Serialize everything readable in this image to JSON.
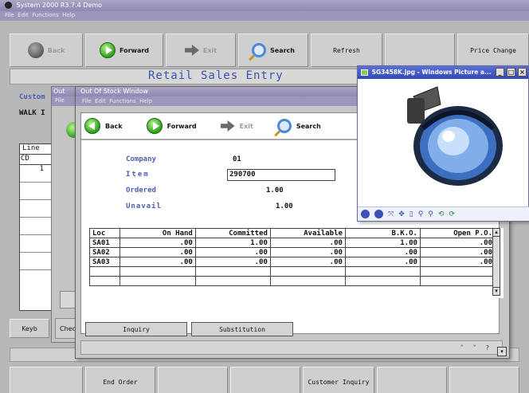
{
  "main_window": {
    "title": "System 2000 R3.7.4 Demo",
    "menu": [
      "File",
      "Edit",
      "Functions",
      "Help"
    ],
    "toolbar": {
      "back": "Back",
      "forward": "Forward",
      "exit": "Exit",
      "search": "Search",
      "refresh": "Refresh",
      "price_change": "Price Change"
    },
    "heading": "Retail Sales Entry",
    "customer_label": "Custom",
    "customer_value": "WALK I",
    "grid_headers": [
      "Line",
      "CD"
    ],
    "grid_first_row": "1",
    "keyb_label": "Keyb",
    "bottom_buttons": [
      "End Order",
      "Customer Inquiry"
    ]
  },
  "mid_window": {
    "title": "Out",
    "menu": [
      "File"
    ],
    "check_label": "Chec"
  },
  "oos_window": {
    "title": "Out Of Stock Window",
    "menu": [
      "File",
      "Edit",
      "Functions",
      "Help"
    ],
    "toolbar": {
      "back": "Back",
      "forward": "Forward",
      "exit": "Exit",
      "search": "Search"
    },
    "fields": {
      "company_label": "Company",
      "company_value": "01",
      "item_label": "Item",
      "item_value": "290700",
      "ordered_label": "Ordered",
      "ordered_value": "1.00",
      "unavail_label": "Unavail",
      "unavail_value": "1.00"
    },
    "table": {
      "headers": [
        "Loc",
        "On Hand",
        "Committed",
        "Available",
        "B.K.O.",
        "Open P.O."
      ],
      "rows": [
        [
          "SA01",
          ".00",
          "1.00",
          ".00",
          "1.00",
          ".00"
        ],
        [
          "SA02",
          ".00",
          ".00",
          ".00",
          ".00",
          ".00"
        ],
        [
          "SA03",
          ".00",
          ".00",
          ".00",
          ".00",
          ".00"
        ],
        [
          "",
          "",
          "",
          "",
          "",
          ""
        ],
        [
          "",
          "",
          "",
          "",
          "",
          ""
        ]
      ]
    },
    "buttons": {
      "inquiry": "Inquiry",
      "substitution": "Substitution"
    }
  },
  "picture_viewer": {
    "title": "SG3458K.jpg - Windows Picture a...",
    "window_controls": [
      "_",
      "□",
      "×"
    ]
  }
}
